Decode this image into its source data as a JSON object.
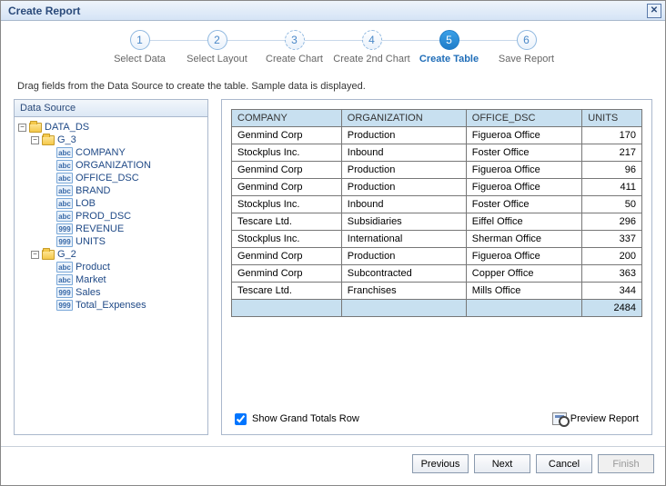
{
  "title": "Create Report",
  "steps": [
    {
      "num": "1",
      "label": "Select Data",
      "state": "done"
    },
    {
      "num": "2",
      "label": "Select Layout",
      "state": "done"
    },
    {
      "num": "3",
      "label": "Create Chart",
      "state": "dashed"
    },
    {
      "num": "4",
      "label": "Create 2nd Chart",
      "state": "dashed"
    },
    {
      "num": "5",
      "label": "Create Table",
      "state": "active"
    },
    {
      "num": "6",
      "label": "Save Report",
      "state": "pending"
    }
  ],
  "instruction": "Drag fields from the Data Source to create the table. Sample data is displayed.",
  "data_source": {
    "header": "Data Source",
    "root": {
      "label": "DATA_DS",
      "expanded": true
    },
    "groups": [
      {
        "label": "G_3",
        "expanded": true,
        "fields": [
          {
            "label": "COMPANY",
            "type": "abc"
          },
          {
            "label": "ORGANIZATION",
            "type": "abc"
          },
          {
            "label": "OFFICE_DSC",
            "type": "abc"
          },
          {
            "label": "BRAND",
            "type": "abc"
          },
          {
            "label": "LOB",
            "type": "abc"
          },
          {
            "label": "PROD_DSC",
            "type": "abc"
          },
          {
            "label": "REVENUE",
            "type": "999"
          },
          {
            "label": "UNITS",
            "type": "999"
          }
        ]
      },
      {
        "label": "G_2",
        "expanded": true,
        "fields": [
          {
            "label": "Product",
            "type": "abc"
          },
          {
            "label": "Market",
            "type": "abc"
          },
          {
            "label": "Sales",
            "type": "999"
          },
          {
            "label": "Total_Expenses",
            "type": "999"
          }
        ]
      }
    ]
  },
  "table": {
    "columns": [
      "COMPANY",
      "ORGANIZATION",
      "OFFICE_DSC",
      "UNITS"
    ],
    "rows": [
      [
        "Genmind Corp",
        "Production",
        "Figueroa Office",
        "170"
      ],
      [
        "Stockplus Inc.",
        "Inbound",
        "Foster Office",
        "217"
      ],
      [
        "Genmind Corp",
        "Production",
        "Figueroa Office",
        "96"
      ],
      [
        "Genmind Corp",
        "Production",
        "Figueroa Office",
        "411"
      ],
      [
        "Stockplus Inc.",
        "Inbound",
        "Foster Office",
        "50"
      ],
      [
        "Tescare Ltd.",
        "Subsidiaries",
        "Eiffel Office",
        "296"
      ],
      [
        "Stockplus Inc.",
        "International",
        "Sherman Office",
        "337"
      ],
      [
        "Genmind Corp",
        "Production",
        "Figueroa Office",
        "200"
      ],
      [
        "Genmind Corp",
        "Subcontracted",
        "Copper Office",
        "363"
      ],
      [
        "Tescare Ltd.",
        "Franchises",
        "Mills Office",
        "344"
      ]
    ],
    "grand_total": [
      "",
      "",
      "",
      "2484"
    ]
  },
  "options": {
    "show_grand_totals_label": "Show Grand Totals Row",
    "show_grand_totals_checked": true,
    "preview_label": "Preview Report"
  },
  "buttons": {
    "previous": "Previous",
    "next": "Next",
    "cancel": "Cancel",
    "finish": "Finish"
  }
}
